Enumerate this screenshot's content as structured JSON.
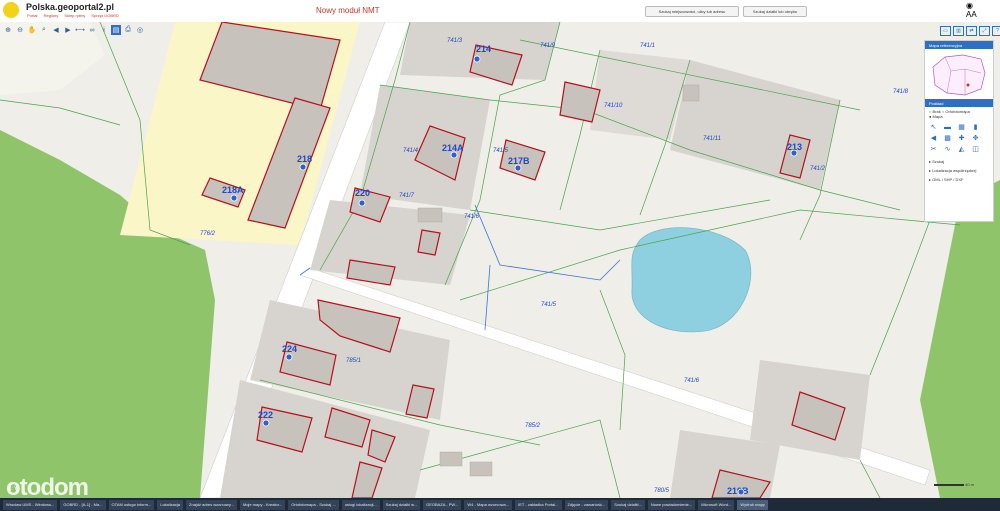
{
  "header": {
    "title": "Polska.geoportal2.pl",
    "links": [
      "Portal",
      "Regiony",
      "Sklep rybny",
      "Sprzęt GOBRD"
    ],
    "nmt_link": "Nowy moduł NMT",
    "search_address_button": "Szukaj miejscowości, ulicy lub adresu",
    "search_parcel_button": "Szukaj działki lub obrębu",
    "font_size_label": "AA"
  },
  "panel": {
    "overview_title": "Mapa referencyjna",
    "layers_title": "Podkład",
    "radio_labels": [
      "Brak",
      "Ortofotomapa",
      "Mapa"
    ],
    "links": [
      "Szukaj",
      "Lokalizacja współrzędnej",
      "GML / SHP / DXF"
    ]
  },
  "map": {
    "building_labels": [
      {
        "id": "b1",
        "text": "214"
      },
      {
        "id": "b2",
        "text": "218"
      },
      {
        "id": "b3",
        "text": "218A"
      },
      {
        "id": "b4",
        "text": "214A"
      },
      {
        "id": "b5",
        "text": "217B"
      },
      {
        "id": "b6",
        "text": "220"
      },
      {
        "id": "b7",
        "text": "224"
      },
      {
        "id": "b8",
        "text": "222"
      },
      {
        "id": "b9",
        "text": "213"
      },
      {
        "id": "b10",
        "text": "219B"
      }
    ],
    "parcel_labels": [
      {
        "id": "p1",
        "text": "741/3"
      },
      {
        "id": "p2",
        "text": "741/5"
      },
      {
        "id": "p3",
        "text": "741/7"
      },
      {
        "id": "p4",
        "text": "741/4"
      },
      {
        "id": "p5",
        "text": "741/9"
      },
      {
        "id": "p6",
        "text": "741/1"
      },
      {
        "id": "p7",
        "text": "741/10"
      },
      {
        "id": "p8",
        "text": "741/11"
      },
      {
        "id": "p9",
        "text": "741/2"
      },
      {
        "id": "p10",
        "text": "741/6"
      },
      {
        "id": "p11",
        "text": "741/5"
      },
      {
        "id": "p12",
        "text": "785/1"
      },
      {
        "id": "p13",
        "text": "785/2"
      },
      {
        "id": "p14",
        "text": "776/2"
      },
      {
        "id": "p15",
        "text": "741/6"
      },
      {
        "id": "p16",
        "text": "741/8"
      },
      {
        "id": "p17",
        "text": "780/5"
      }
    ]
  },
  "colors": {
    "parcel_fill": "#efeee8",
    "building_outline": "#b3121c",
    "building_fill": "#c8c2bd",
    "forest": "#8fc46a",
    "pond": "#8fd0e0",
    "yellow_zone": "#fbf6c8",
    "road": "#ffffff",
    "boundary_green": "#4aa34a",
    "boundary_blue": "#3a74d8",
    "label_blue": "#1f47c8"
  },
  "scale_label": "40 m",
  "coords_text": "X:  Y:",
  "watermark": "otodom",
  "taskbar": [
    "Wrocław UMS - Windows...",
    "GOBRD - [A-1] - Ma...",
    "OTAM usługa inform...",
    "Lokalizacja",
    "Znajdź adres wzorcowy...",
    "Moje mapy - Kreator...",
    "Ortofotomapa - Szukaj ...",
    "usługi lokalizacji...",
    "Szukaj działki w...",
    "GEOBAZA - PW...",
    "W4 - Mapa wzorcowa...",
    "IET - zakładka Portal...",
    "Zdjęcie - zawartość...",
    "Szukaj działki...",
    "Nowe powiadomienie...",
    "Microsoft Word...",
    "Wydruk mapy"
  ]
}
